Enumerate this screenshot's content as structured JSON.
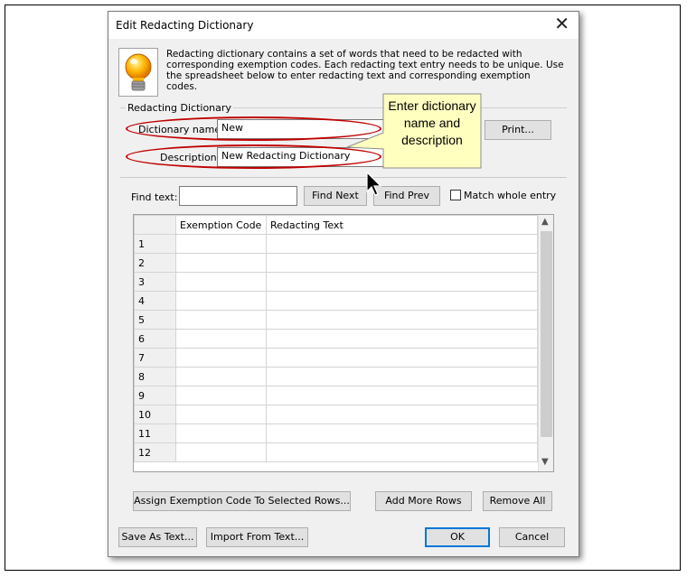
{
  "window": {
    "title": "Edit Redacting Dictionary",
    "close_glyph": "✕"
  },
  "intro_text": "Redacting dictionary contains a set of words that need to be redacted with corresponding exemption codes. Each redacting text entry needs to be unique. Use the spreadsheet below to enter redacting text and corresponding exemption codes.",
  "group_label": "Redacting Dictionary",
  "dictionary_name": {
    "label": "Dictionary name:",
    "value": "New"
  },
  "description": {
    "label": "Description:",
    "value": "New Redacting Dictionary"
  },
  "print_button": "Print...",
  "callout": "Enter dictionary name and description",
  "find": {
    "label": "Find text:",
    "value": "",
    "next_button": "Find Next",
    "prev_button": "Find Prev",
    "match_label": "Match whole entry",
    "match_checked": false
  },
  "grid": {
    "columns": [
      "Exemption Code",
      "Redacting Text"
    ],
    "rows": [
      "1",
      "2",
      "3",
      "4",
      "5",
      "6",
      "7",
      "8",
      "9",
      "10",
      "11",
      "12"
    ]
  },
  "buttons": {
    "assign": "Assign Exemption Code To Selected Rows...",
    "add_rows": "Add More Rows",
    "remove_all": "Remove All",
    "save_as_text": "Save As Text...",
    "import_from_text": "Import From Text...",
    "ok": "OK",
    "cancel": "Cancel"
  },
  "colors": {
    "annotation": "#c00000",
    "callout_fill": "#ffffc0",
    "focus": "#0078d7"
  },
  "icons": [
    "lightbulb-icon",
    "close-icon",
    "mouse-pointer-icon"
  ]
}
